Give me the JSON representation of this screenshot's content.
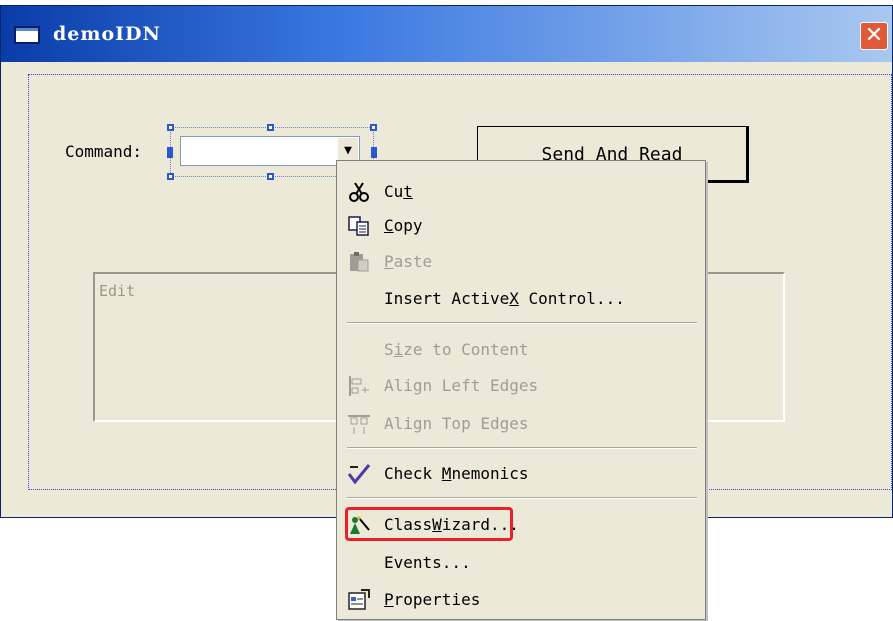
{
  "window": {
    "title": "demoIDN",
    "close_glyph": "✕"
  },
  "dialog": {
    "command_label": "Command:",
    "combo_arrow_glyph": "▼",
    "send_button_label": "Send And Read",
    "edit_label": "Edit"
  },
  "context_menu": {
    "cut": {
      "pre": "Cu",
      "key": "t",
      "post": ""
    },
    "copy": {
      "pre": "",
      "key": "C",
      "post": "opy"
    },
    "paste": {
      "pre": "",
      "key": "P",
      "post": "aste"
    },
    "insert_activex": {
      "pre": "Insert Active",
      "key": "X",
      "post": " Control..."
    },
    "size_to_content": {
      "pre": "S",
      "key": "i",
      "post": "ze to Content"
    },
    "align_left": {
      "pre": "Align Left Edges"
    },
    "align_top": {
      "pre": "Align Top Edges"
    },
    "check_mnemonics": {
      "pre": "Check ",
      "key": "M",
      "post": "nemonics"
    },
    "classwizard": {
      "pre": "Class",
      "key": "W",
      "post": "izard..."
    },
    "events": {
      "pre": "Events..."
    },
    "properties": {
      "pre": "",
      "key": "P",
      "post": "roperties"
    }
  },
  "colors": {
    "highlight_border": "#e8212b",
    "title_start": "#0a3ca8",
    "dialog_bg": "#ece9d8"
  }
}
